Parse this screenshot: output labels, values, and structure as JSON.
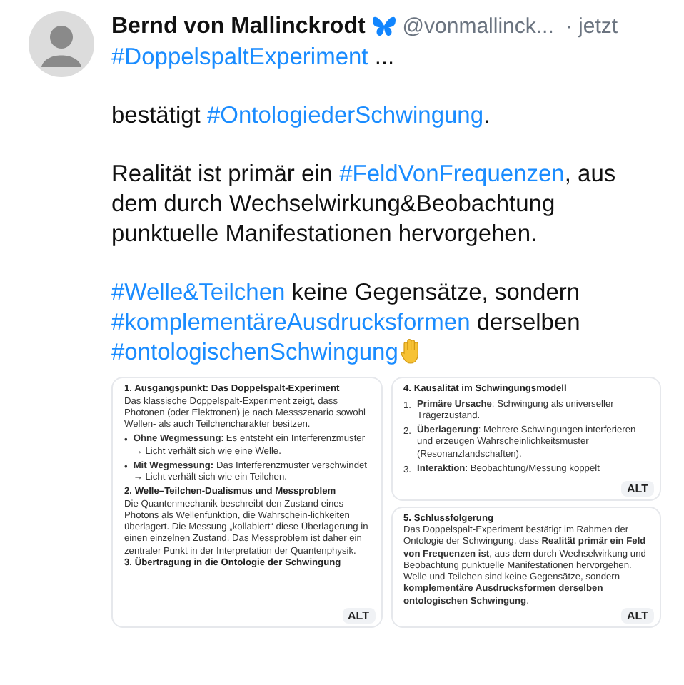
{
  "author": {
    "name": "Bernd von Mallinckrodt",
    "handle": "@vonmallinck...",
    "time": "· jetzt"
  },
  "paragraphs": [
    [
      {
        "kind": "hashtag",
        "text": "#DoppelspaltExperiment"
      },
      {
        "kind": "text",
        "text": " ..."
      }
    ],
    [
      {
        "kind": "text",
        "text": "bestätigt "
      },
      {
        "kind": "hashtag",
        "text": "#OntologiederSchwingung"
      },
      {
        "kind": "text",
        "text": "."
      }
    ],
    [
      {
        "kind": "text",
        "text": "Realität ist primär ein "
      },
      {
        "kind": "hashtag",
        "text": "#FeldVonFrequenzen"
      },
      {
        "kind": "text",
        "text": ", aus dem durch Wechselwirkung&Beobachtung punktuelle Manifestationen hervorgehen."
      }
    ],
    [
      {
        "kind": "hashtag",
        "text": "#Welle&Teilchen"
      },
      {
        "kind": "text",
        "text": " keine Gegensätze, sondern "
      },
      {
        "kind": "hashtag",
        "text": "#komplementäreAusdrucksformen"
      },
      {
        "kind": "text",
        "text": " derselben "
      },
      {
        "kind": "hashtag",
        "text": "#ontologischenSchwingung"
      }
    ]
  ],
  "images": [
    {
      "alt_badge": "ALT",
      "blocks": [
        {
          "kind": "heading",
          "text": "1. Ausgangspunkt: Das Doppelspalt-Experiment"
        },
        {
          "kind": "paragraph",
          "text": "Das klassische Doppelspalt-Experiment zeigt, dass Photonen (oder Elektronen) je nach Messszenario sowohl Wellen- als auch Teilchencharakter besitzen."
        },
        {
          "kind": "bullet",
          "marker": "•",
          "text": "**Ohne Wegmessung**: Es entsteht ein Interferenzmuster → Licht verhält sich wie eine Welle."
        },
        {
          "kind": "bullet",
          "marker": "•",
          "text": "**Mit Wegmessung:** Das Interferenzmuster verschwindet → Licht verhält sich wie ein Teilchen."
        },
        {
          "kind": "heading",
          "text": "2. Welle–Teilchen-Dualismus und Messproblem"
        },
        {
          "kind": "paragraph",
          "text": "Die Quantenmechanik beschreibt den Zustand eines Photons als Wellenfunktion, die Wahrschein-lichkeiten überlagert. Die Messung „kollabiert“ diese Überlagerung in einen einzelnen Zustand. Das Messproblem ist daher ein zentraler Punkt in der Interpretation der Quantenphysik."
        },
        {
          "kind": "heading",
          "text": "3. Übertragung in die Ontologie der Schwingung"
        }
      ]
    },
    {
      "alt_badge": "ALT",
      "blocks": [
        {
          "kind": "heading",
          "text": "4. Kausalität im Schwingungsmodell"
        },
        {
          "kind": "bullet",
          "marker": "1.",
          "text": "**Primäre Ursache**: Schwingung als universeller Trägerzustand."
        },
        {
          "kind": "bullet",
          "marker": "2.",
          "text": "**Überlagerung**: Mehrere Schwingungen interferieren und erzeugen Wahrscheinlichkeitsmuster (Resonanzlandschaften)."
        },
        {
          "kind": "bullet",
          "marker": "3.",
          "text": "**Interaktion**: Beobachtung/Messung koppelt"
        }
      ]
    },
    {
      "alt_badge": "ALT",
      "blocks": [
        {
          "kind": "heading",
          "text": "5. Schlussfolgerung"
        },
        {
          "kind": "paragraph",
          "text": "Das Doppelspalt-Experiment bestätigt im Rahmen der Ontologie der Schwingung, dass **Realität primär ein Feld von Frequenzen ist**, aus dem durch Wechselwirkung und Beobachtung punktuelle Manifestationen hervorgehen. Welle und Teilchen sind keine Gegensätze, sondern **komplementäre Ausdrucksformen derselben ontologischen Schwingung**."
        }
      ]
    }
  ]
}
